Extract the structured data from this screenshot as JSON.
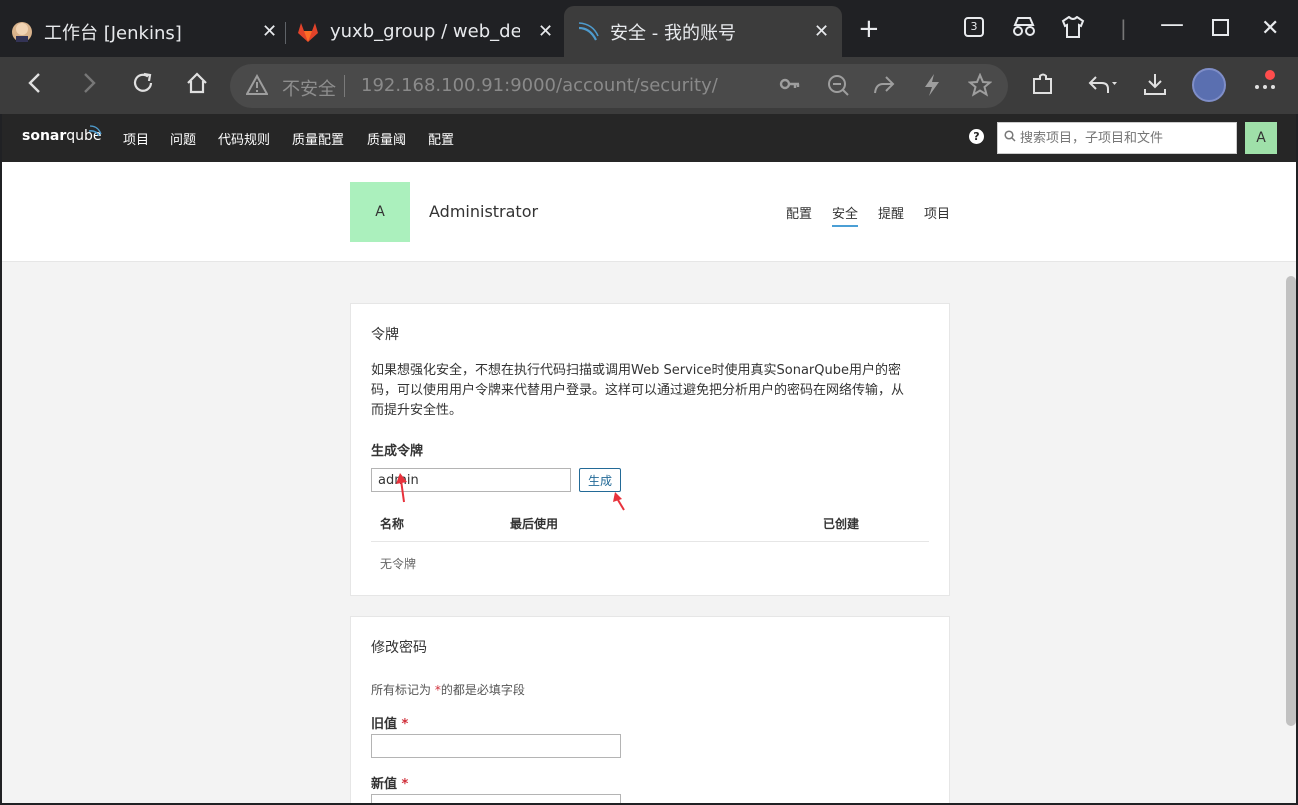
{
  "browser": {
    "tabs": [
      {
        "title": "工作台 [Jenkins]",
        "favicon": "jenkins-icon"
      },
      {
        "title": "yuxb_group / web_demo",
        "favicon": "gitlab-icon"
      },
      {
        "title": "安全 - 我的账号",
        "favicon": "sonarqube-icon",
        "active": true
      }
    ],
    "tab_count_badge": "3",
    "new_tab_symbol": "+",
    "not_secure_label": "不安全",
    "url": "192.168.100.91:9000/account/security/"
  },
  "sonar": {
    "logo_bold": "sonar",
    "logo_regular": "qube",
    "menu": [
      "项目",
      "问题",
      "代码规则",
      "质量配置",
      "质量阈",
      "配置"
    ],
    "help_symbol": "?",
    "search_placeholder": "搜索项目，子项目和文件",
    "user_initial": "A"
  },
  "account": {
    "avatar_initial": "A",
    "name": "Administrator",
    "tabs": [
      "配置",
      "安全",
      "提醒",
      "项目"
    ],
    "active_tab": "安全"
  },
  "tokens": {
    "title": "令牌",
    "description": "如果想强化安全，不想在执行代码扫描或调用Web Service时使用真实SonarQube用户的密码，可以使用用户令牌来代替用户登录。这样可以通过避免把分析用户的密码在网络传输，从而提升安全性。",
    "generate_heading": "生成令牌",
    "token_name_value": "admin",
    "generate_button": "生成",
    "columns": [
      "名称",
      "最后使用",
      "已创建"
    ],
    "empty_text": "无令牌"
  },
  "password": {
    "title": "修改密码",
    "required_note_prefix": "所有标记为",
    "required_note_star": "*",
    "required_note_suffix": "的都是必填字段",
    "old_label": "旧值",
    "new_label": "新值",
    "required_star": "*"
  },
  "colors": {
    "sonar_nav": "#262626",
    "avatar_green": "#abf0bd",
    "link_blue": "#236a97",
    "active_tab_underline": "#4b9fd5",
    "annotation_red": "#e8323c"
  }
}
